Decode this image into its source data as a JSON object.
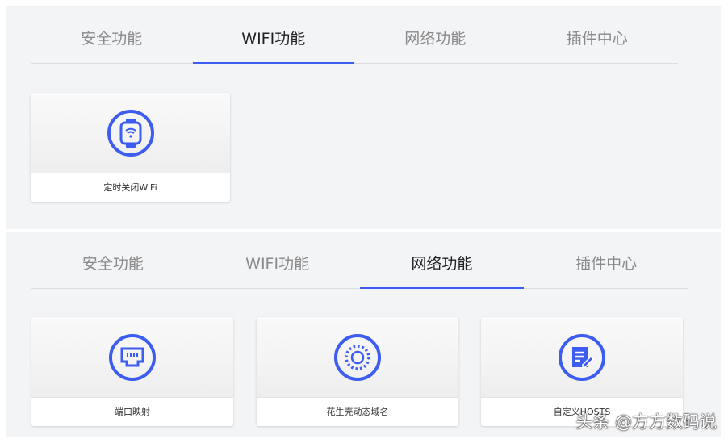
{
  "panel1": {
    "tabs": [
      "安全功能",
      "WIFI功能",
      "网络功能",
      "插件中心"
    ],
    "active": 1,
    "cards": [
      {
        "label": "定时关闭WiFi",
        "icon": "wifi-watch-icon"
      }
    ]
  },
  "panel2": {
    "tabs": [
      "安全功能",
      "WIFI功能",
      "网络功能",
      "插件中心"
    ],
    "active": 2,
    "cards": [
      {
        "label": "端口映射",
        "icon": "ethernet-port-icon"
      },
      {
        "label": "花生壳动态域名",
        "icon": "dotted-circle-icon"
      },
      {
        "label": "自定义HOSTS",
        "icon": "edit-document-icon"
      }
    ]
  },
  "watermark": "头条 @方方数码说",
  "accent": "#3d5cf0"
}
